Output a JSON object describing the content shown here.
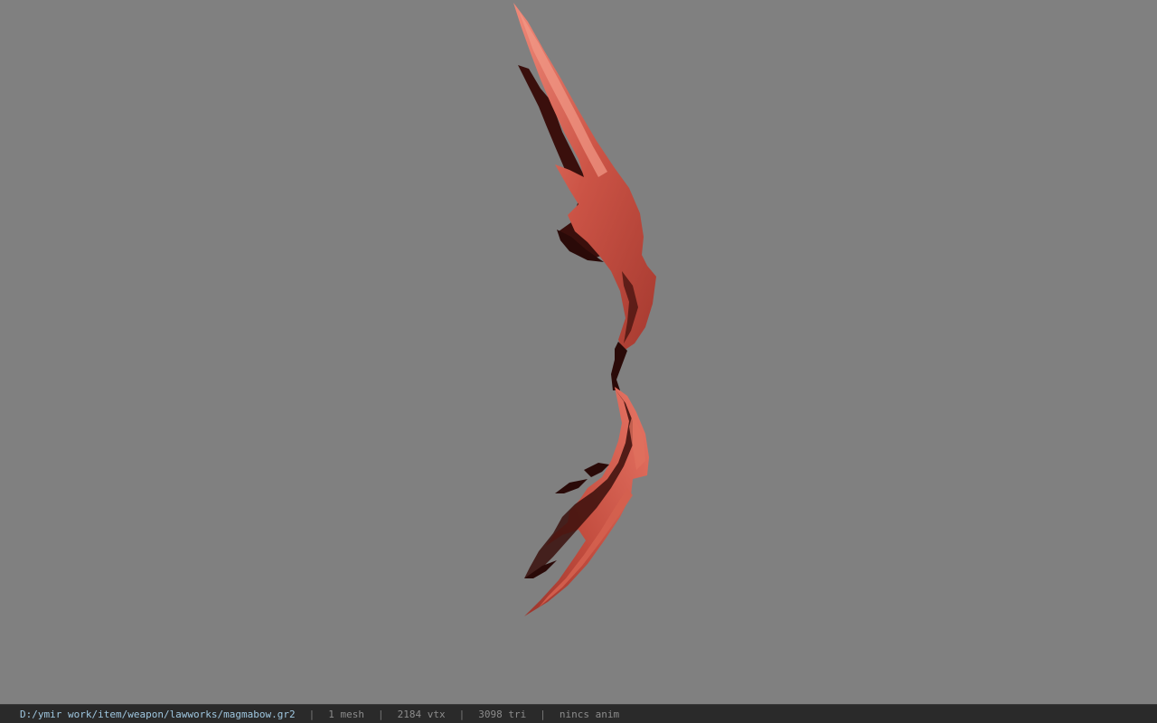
{
  "status_bar": {
    "file_path": "D:/ymir work/item/weapon/lawworks/magmabow.gr2",
    "separator": "|",
    "mesh_count": "1 mesh",
    "vertex_count": "2184 vtx",
    "triangle_count": "3098 tri",
    "animation": "nincs anim"
  },
  "colors": {
    "viewport_background": "#808080",
    "status_bar_background": "#2a2a2a",
    "path_text": "#9fc7e0",
    "stat_text": "#8c8c8c",
    "model_red_light": "#e06a5a",
    "model_red": "#b8473c",
    "model_dark": "#3a0f0c"
  },
  "viewport": {
    "model": "magma-bow-3d-model"
  }
}
